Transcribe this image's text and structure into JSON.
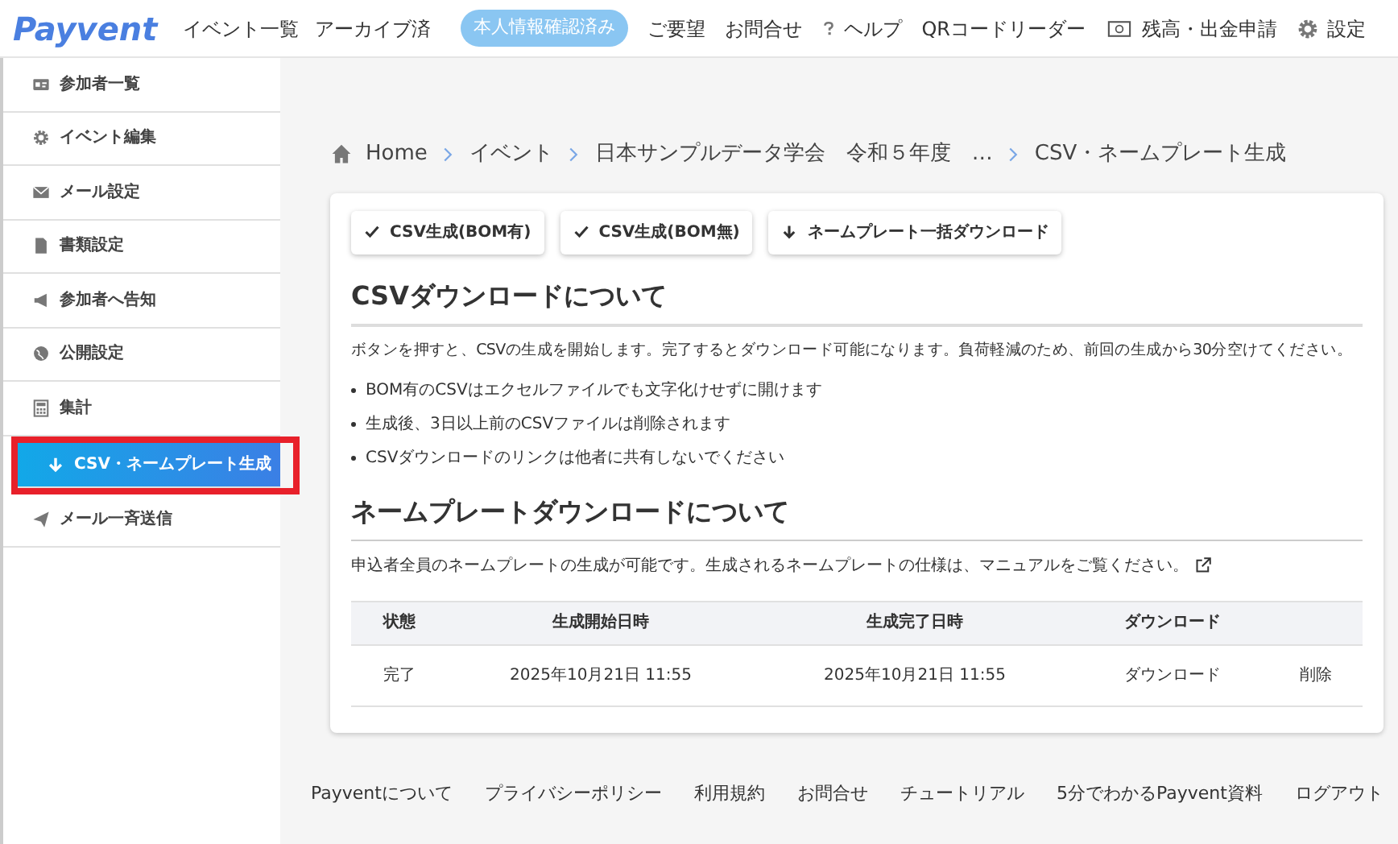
{
  "header": {
    "logo": "Payvent",
    "nav": [
      "イベント一覧",
      "アーカイブ済"
    ],
    "badge": "本人情報確認済み",
    "links": [
      {
        "kind": "plain",
        "label": "ご要望"
      },
      {
        "kind": "plain",
        "label": "お問合せ"
      },
      {
        "kind": "help",
        "label": "ヘルプ"
      },
      {
        "kind": "plain",
        "label": "QRコードリーダー"
      },
      {
        "kind": "money",
        "label": "残高・出金申請"
      },
      {
        "kind": "gear",
        "label": "設定"
      }
    ]
  },
  "sidebar": {
    "items": [
      {
        "kind": "card",
        "label": "参加者一覧",
        "selected": false,
        "highlighted": false
      },
      {
        "kind": "gear",
        "label": "イベント編集",
        "selected": false,
        "highlighted": false
      },
      {
        "kind": "mail",
        "label": "メール設定",
        "selected": false,
        "highlighted": false
      },
      {
        "kind": "file",
        "label": "書類設定",
        "selected": false,
        "highlighted": false
      },
      {
        "kind": "megaphone",
        "label": "参加者へ告知",
        "selected": false,
        "highlighted": false
      },
      {
        "kind": "globe",
        "label": "公開設定",
        "selected": false,
        "highlighted": false
      },
      {
        "kind": "calculator",
        "label": "集計",
        "selected": false,
        "highlighted": false
      },
      {
        "kind": "download",
        "label": "CSV・ネームプレート生成",
        "selected": true,
        "highlighted": true
      },
      {
        "kind": "send",
        "label": "メール一斉送信",
        "selected": false,
        "highlighted": false
      }
    ]
  },
  "breadcrumb": [
    "Home",
    "イベント",
    "日本サンプルデータ学会　令和５年度　…",
    "CSV・ネームプレート生成"
  ],
  "buttons": [
    {
      "kind": "check",
      "label": "CSV生成(BOM有)"
    },
    {
      "kind": "check",
      "label": "CSV生成(BOM無)"
    },
    {
      "kind": "download",
      "label": "ネームプレート一括ダウンロード"
    }
  ],
  "csv_section": {
    "heading": "CSVダウンロードについて",
    "text": "ボタンを押すと、CSVの生成を開始します。完了するとダウンロード可能になります。負荷軽減のため、前回の生成から30分空けてください。",
    "bullets": [
      "BOM有のCSVはエクセルファイルでも文字化けせずに開けます",
      "生成後、3日以上前のCSVファイルは削除されます",
      "CSVダウンロードのリンクは他者に共有しないでください"
    ]
  },
  "nameplate_section": {
    "heading": "ネームプレートダウンロードについて",
    "text": "申込者全員のネームプレートの生成が可能です。生成されるネームプレートの仕様は、マニュアルをご覧ください。"
  },
  "table": {
    "columns": [
      "状態",
      "生成開始日時",
      "生成完了日時",
      "ダウンロード"
    ],
    "rows": [
      {
        "status": "完了",
        "start": "2025年10月21日 11:55",
        "end": "2025年10月21日 11:55",
        "download": "ダウンロード",
        "delete": "削除"
      }
    ]
  },
  "footer": [
    "Payventについて",
    "プライバシーポリシー",
    "利用規約",
    "お問合せ",
    "チュートリアル",
    "5分でわかるPayvent資料",
    "ログアウト"
  ]
}
